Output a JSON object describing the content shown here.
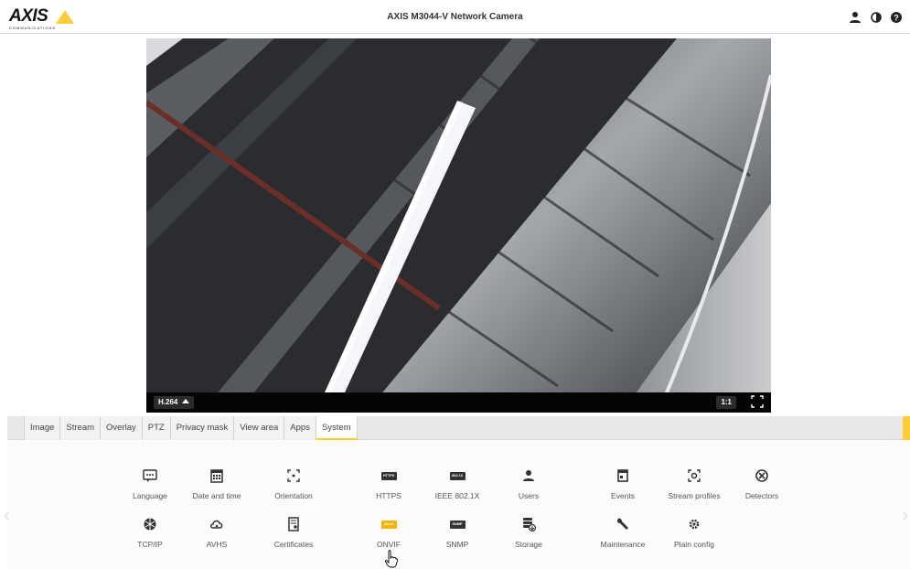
{
  "header": {
    "logo_text": "AXIS",
    "logo_subtext": "COMMUNICATIONS",
    "title": "AXIS M3044-V Network Camera",
    "icons": [
      "user-icon",
      "contrast-icon",
      "help-icon"
    ]
  },
  "video": {
    "codec_label": "H.264",
    "scale_label": "1:1"
  },
  "tabs": [
    {
      "label": "Image"
    },
    {
      "label": "Stream"
    },
    {
      "label": "Overlay"
    },
    {
      "label": "PTZ"
    },
    {
      "label": "Privacy mask"
    },
    {
      "label": "View area"
    },
    {
      "label": "Apps"
    },
    {
      "label": "System",
      "active": true
    }
  ],
  "system_items_row1": [
    {
      "label": "Language",
      "icon": "language-icon"
    },
    {
      "label": "Date and time",
      "icon": "calendar-icon"
    },
    {
      "label": "Orientation",
      "icon": "orientation-icon"
    },
    {
      "label": "HTTPS",
      "icon": "https-chip-icon",
      "chip": "HTTPS"
    },
    {
      "label": "IEEE 802.1X",
      "icon": "ieee-chip-icon",
      "chip": "802.1X"
    },
    {
      "label": "Users",
      "icon": "user-icon"
    },
    {
      "label": "Events",
      "icon": "event-calendar-icon"
    },
    {
      "label": "Stream profiles",
      "icon": "stream-profiles-icon"
    },
    {
      "label": "Detectors",
      "icon": "detectors-icon"
    }
  ],
  "system_items_row2": [
    {
      "label": "TCP/IP",
      "icon": "network-globe-icon"
    },
    {
      "label": "AVHS",
      "icon": "cloud-icon"
    },
    {
      "label": "Certificates",
      "icon": "certificate-icon"
    },
    {
      "label": "ONVIF",
      "icon": "onvif-chip-icon",
      "chip": "Onvif"
    },
    {
      "label": "SNMP",
      "icon": "snmp-chip-icon",
      "chip": "SNMP"
    },
    {
      "label": "Storage",
      "icon": "storage-icon"
    },
    {
      "label": "Maintenance",
      "icon": "wrench-icon"
    },
    {
      "label": "Plain config",
      "icon": "gear-icon"
    }
  ],
  "colors": {
    "accent": "#ffcc33",
    "video_bar": "#050505"
  }
}
